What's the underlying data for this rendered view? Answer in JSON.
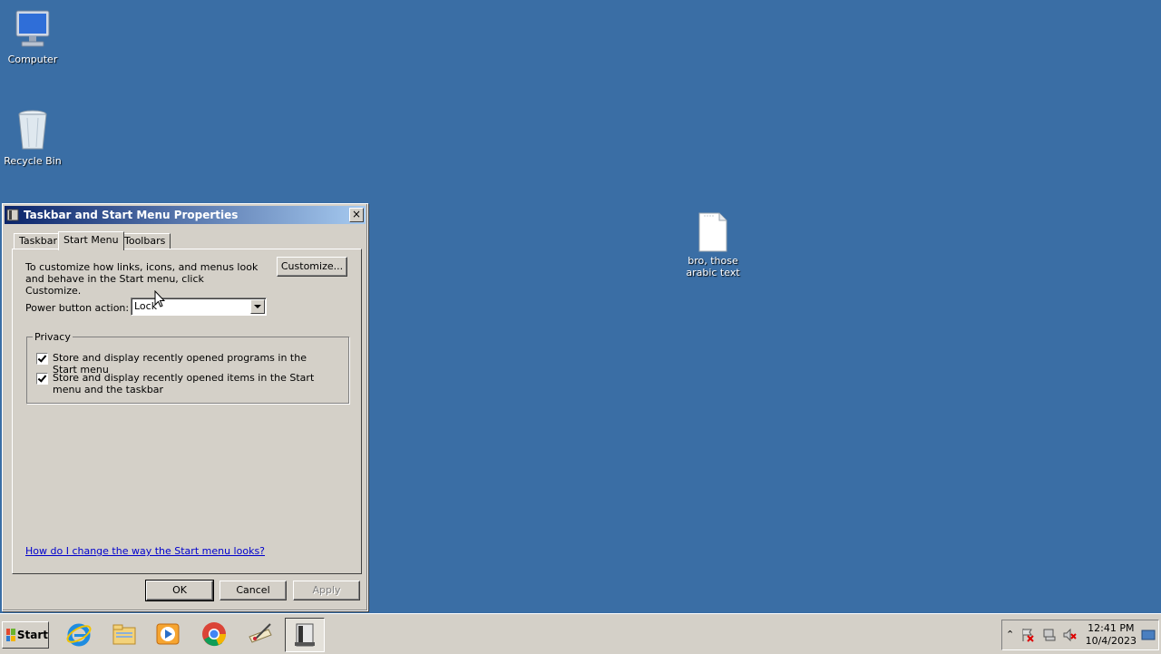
{
  "desktop": {
    "icons": [
      {
        "label": "Computer"
      },
      {
        "label": "Recycle Bin"
      },
      {
        "label_line1": "bro, those",
        "label_line2": "arabic text"
      }
    ]
  },
  "dialog": {
    "title": "Taskbar and Start Menu Properties",
    "close": "×",
    "tabs": [
      "Taskbar",
      "Start Menu",
      "Toolbars"
    ],
    "active_tab": "Start Menu",
    "description": "To customize how links, icons, and menus look and behave in the Start menu, click Customize.",
    "customize_button": "Customize...",
    "power_label": "Power button action:",
    "power_value": "Lock",
    "privacy": {
      "legend": "Privacy",
      "options": [
        {
          "label": "Store and display recently opened programs in the Start menu",
          "checked": true
        },
        {
          "label": "Store and display recently opened items in the Start menu and the taskbar",
          "checked": true
        }
      ]
    },
    "help_link": "How do I change the way the Start menu looks?",
    "buttons": {
      "ok": "OK",
      "cancel": "Cancel",
      "apply": "Apply"
    }
  },
  "taskbar": {
    "start_label": "Start",
    "apps": [
      "internet-explorer-icon",
      "file-explorer-icon",
      "media-player-icon",
      "chrome-icon",
      "paint-icon",
      "taskbar-properties-icon"
    ],
    "clock_time": "12:41 PM",
    "clock_date": "10/4/2023"
  }
}
